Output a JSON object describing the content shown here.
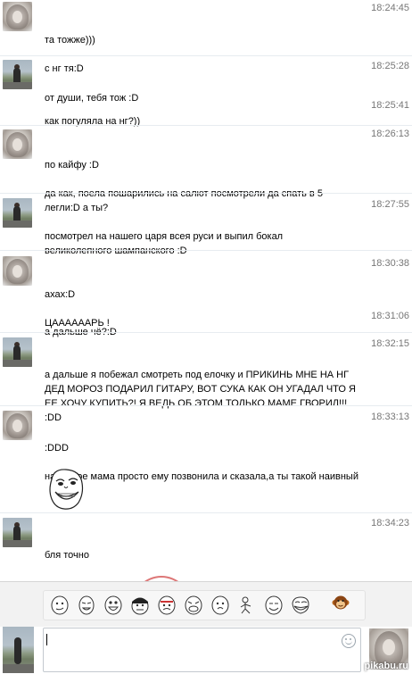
{
  "messages": [
    {
      "author": "girl",
      "time": "18:24:45",
      "lines": [
        "та тожже)))",
        "с нг тя:D"
      ]
    },
    {
      "author": "guy",
      "time": "18:25:28",
      "lines": [
        "от души, тебя тож :D"
      ]
    },
    {
      "author": "guy",
      "time": "18:25:41",
      "lines": [
        "как погуляла на нг?))"
      ]
    },
    {
      "author": "girl",
      "time": "18:26:13",
      "lines": [
        "по кайфу :D",
        "да как, поела пошарились на салют посмотрели да спать в 5 легли:D а ты?"
      ]
    },
    {
      "author": "guy",
      "time": "18:27:55",
      "lines": [
        "посмотрел на нашего царя всея руси и выпил бокал великолепного шампанского :D"
      ]
    },
    {
      "author": "girl",
      "time": "18:30:38",
      "lines": [
        "ахах:D",
        "ЦААААААРЬ !"
      ]
    },
    {
      "author": "girl",
      "time": "18:31:06",
      "lines": [
        "а дальше чё?:D"
      ]
    },
    {
      "author": "guy",
      "time": "18:32:15",
      "lines": [
        "а дальше я побежал смотреть под елочку и ПРИКИНЬ МНЕ НА НГ ДЕД МОРОЗ ПОДАРИЛ ГИТАРУ, ВОТ СУКА КАК ОН УГАДАЛ ЧТО Я ЕЕ ХОЧУ КУПИТЬ?! Я ВЕДЬ ОБ ЭТОМ ТОЛЬКО МАМЕ ГВОРИЛ!!! :DD"
      ]
    },
    {
      "author": "girl",
      "time": "18:33:13",
      "lines": [
        ":DDD",
        "наверное мама просто ему позвонила и сказала,а ты такой наивный"
      ]
    },
    {
      "author": "guy",
      "time": "18:34:23",
      "lines": [
        "бля точно"
      ]
    }
  ],
  "emoji_bar": {
    "icons": [
      "rage-face-1",
      "rage-face-2",
      "rage-face-3",
      "rage-face-4",
      "rage-face-5",
      "rage-face-6",
      "rage-face-7",
      "rage-face-8",
      "rage-face-9",
      "troll-face"
    ],
    "monkey_icon": "monkey-icon"
  },
  "composer": {
    "smile_icon": "smile-icon"
  },
  "watermark": "pikabu.ru"
}
